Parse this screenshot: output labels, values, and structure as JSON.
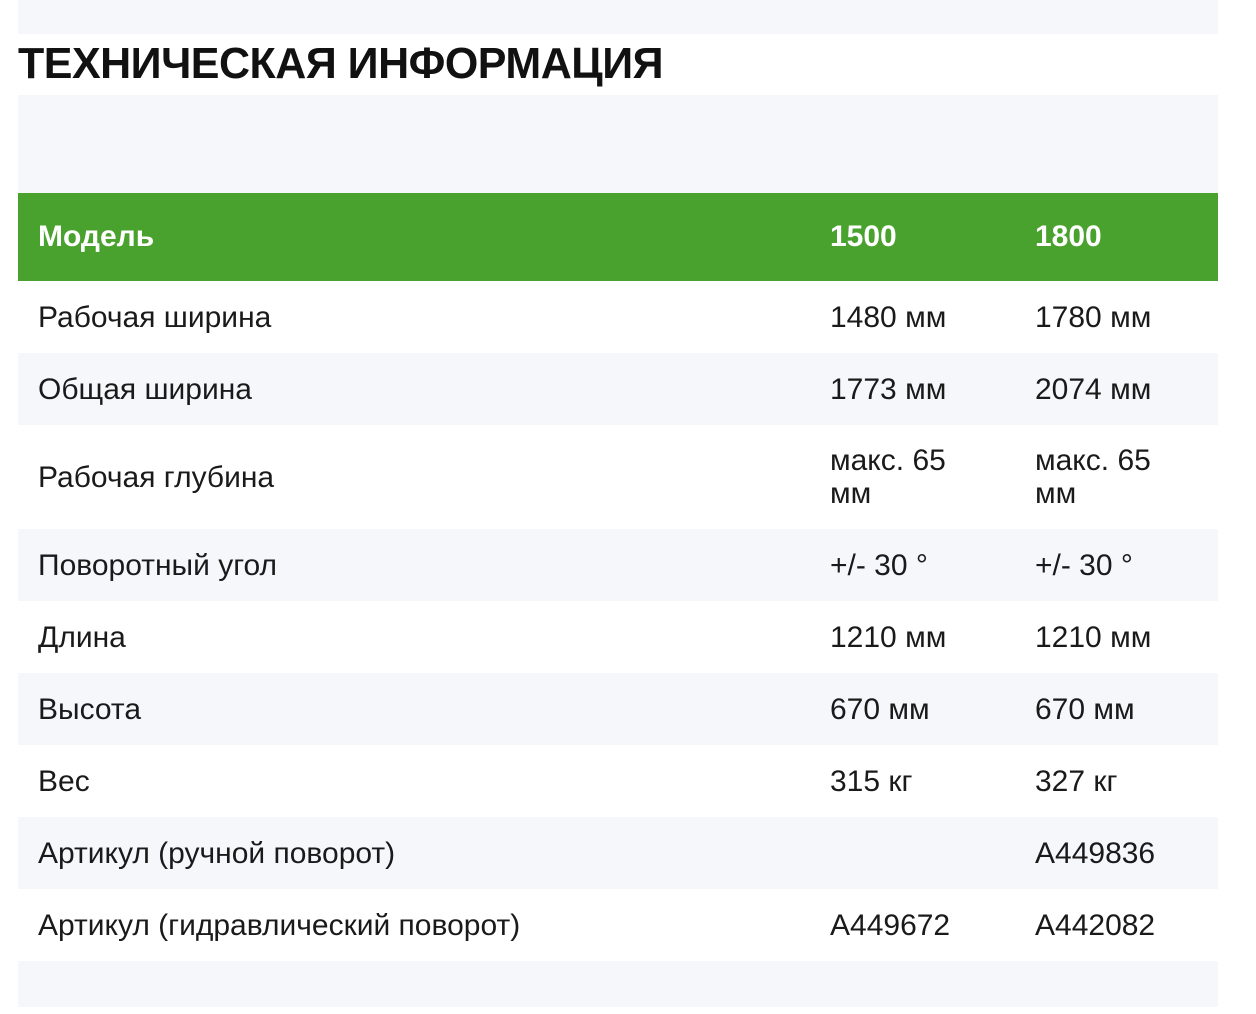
{
  "section": {
    "title": "ТЕХНИЧЕСКАЯ ИНФОРМАЦИЯ"
  },
  "table": {
    "headers": [
      "Модель",
      "1500",
      "1800"
    ],
    "rows": [
      {
        "label": "Рабочая ширина",
        "v1500": "1480 мм",
        "v1800": "1780 мм"
      },
      {
        "label": "Общая ширина",
        "v1500": "1773 мм",
        "v1800": "2074 мм"
      },
      {
        "label": "Рабочая глубина",
        "v1500": "макс. 65 мм",
        "v1800": "макс. 65 мм"
      },
      {
        "label": "Поворотный угол",
        "v1500": "+/- 30 °",
        "v1800": "+/- 30 °"
      },
      {
        "label": "Длина",
        "v1500": "1210 мм",
        "v1800": "1210 мм"
      },
      {
        "label": "Высота",
        "v1500": "670 мм",
        "v1800": "670 мм"
      },
      {
        "label": "Вес",
        "v1500": "315 кг",
        "v1800": "327 кг"
      },
      {
        "label": "Артикул (ручной поворот)",
        "v1500": "",
        "v1800": "A449836"
      },
      {
        "label": "Артикул (гидравлический поворот)",
        "v1500": "A449672",
        "v1800": "A442082"
      }
    ]
  },
  "colors": {
    "header_green": "#4aa22e",
    "stripe": "#f5f7fa",
    "text": "#1a1a1a"
  }
}
